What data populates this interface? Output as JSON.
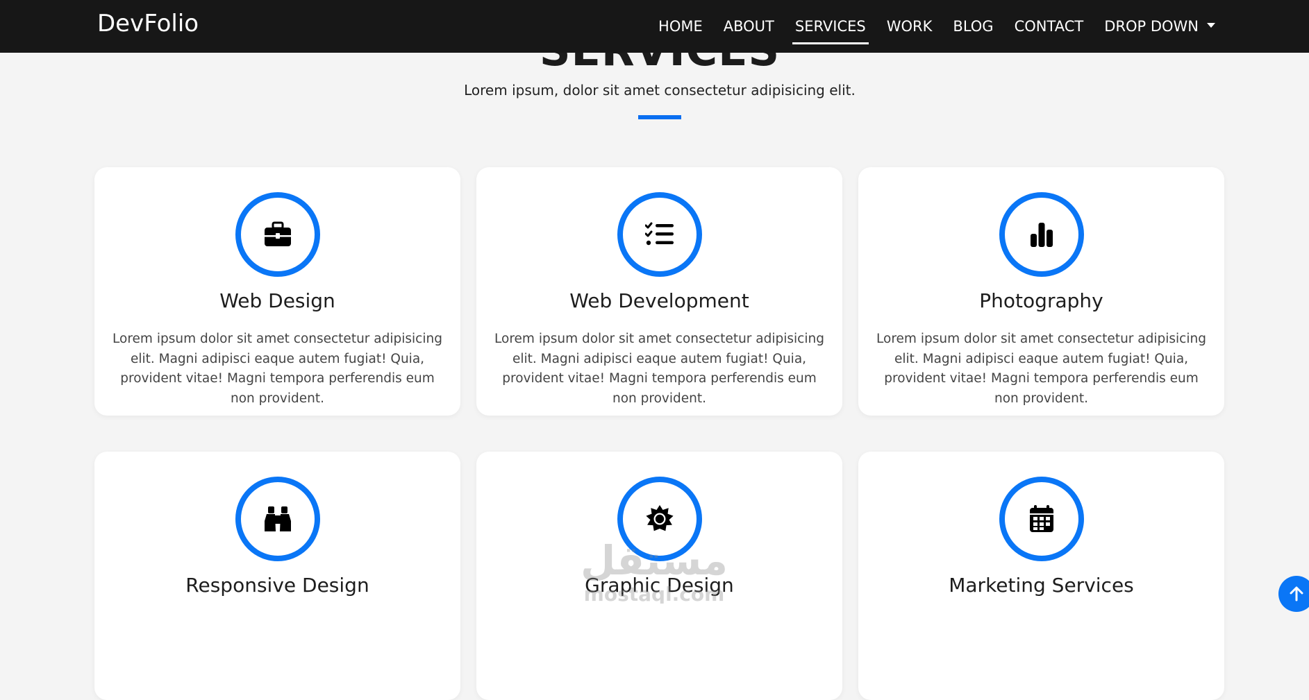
{
  "navbar": {
    "brand": "DevFolio",
    "items": [
      {
        "label": "HOME"
      },
      {
        "label": "ABOUT"
      },
      {
        "label": "SERVICES",
        "active": true
      },
      {
        "label": "WORK"
      },
      {
        "label": "BLOG"
      },
      {
        "label": "CONTACT"
      },
      {
        "label": "DROP DOWN"
      }
    ]
  },
  "section": {
    "title": "SERVICES",
    "subtitle": "Lorem ipsum, dolor sit amet consectetur adipisicing elit."
  },
  "services": [
    {
      "title": "Web Design",
      "icon": "briefcase-icon",
      "text": "Lorem ipsum dolor sit amet consectetur adipisicing elit. Magni adipisci eaque autem fugiat! Quia, provident vitae! Magni tempora perferendis eum non provident."
    },
    {
      "title": "Web Development",
      "icon": "list-check-icon",
      "text": "Lorem ipsum dolor sit amet consectetur adipisicing elit. Magni adipisci eaque autem fugiat! Quia, provident vitae! Magni tempora perferendis eum non provident."
    },
    {
      "title": "Photography",
      "icon": "bar-chart-icon",
      "text": "Lorem ipsum dolor sit amet consectetur adipisicing elit. Magni adipisci eaque autem fugiat! Quia, provident vitae! Magni tempora perferendis eum non provident."
    },
    {
      "title": "Responsive Design",
      "icon": "binoculars-icon",
      "text": ""
    },
    {
      "title": "Graphic Design",
      "icon": "sun-gear-icon",
      "text": ""
    },
    {
      "title": "Marketing Services",
      "icon": "calendar-icon",
      "text": ""
    }
  ],
  "colors": {
    "accent": "#0a76f6",
    "navbar_bg": "#171717",
    "page_bg": "#f4f4f4"
  },
  "watermark": {
    "text_arabic": "مستقل",
    "text_latin": "mostaql.com"
  }
}
